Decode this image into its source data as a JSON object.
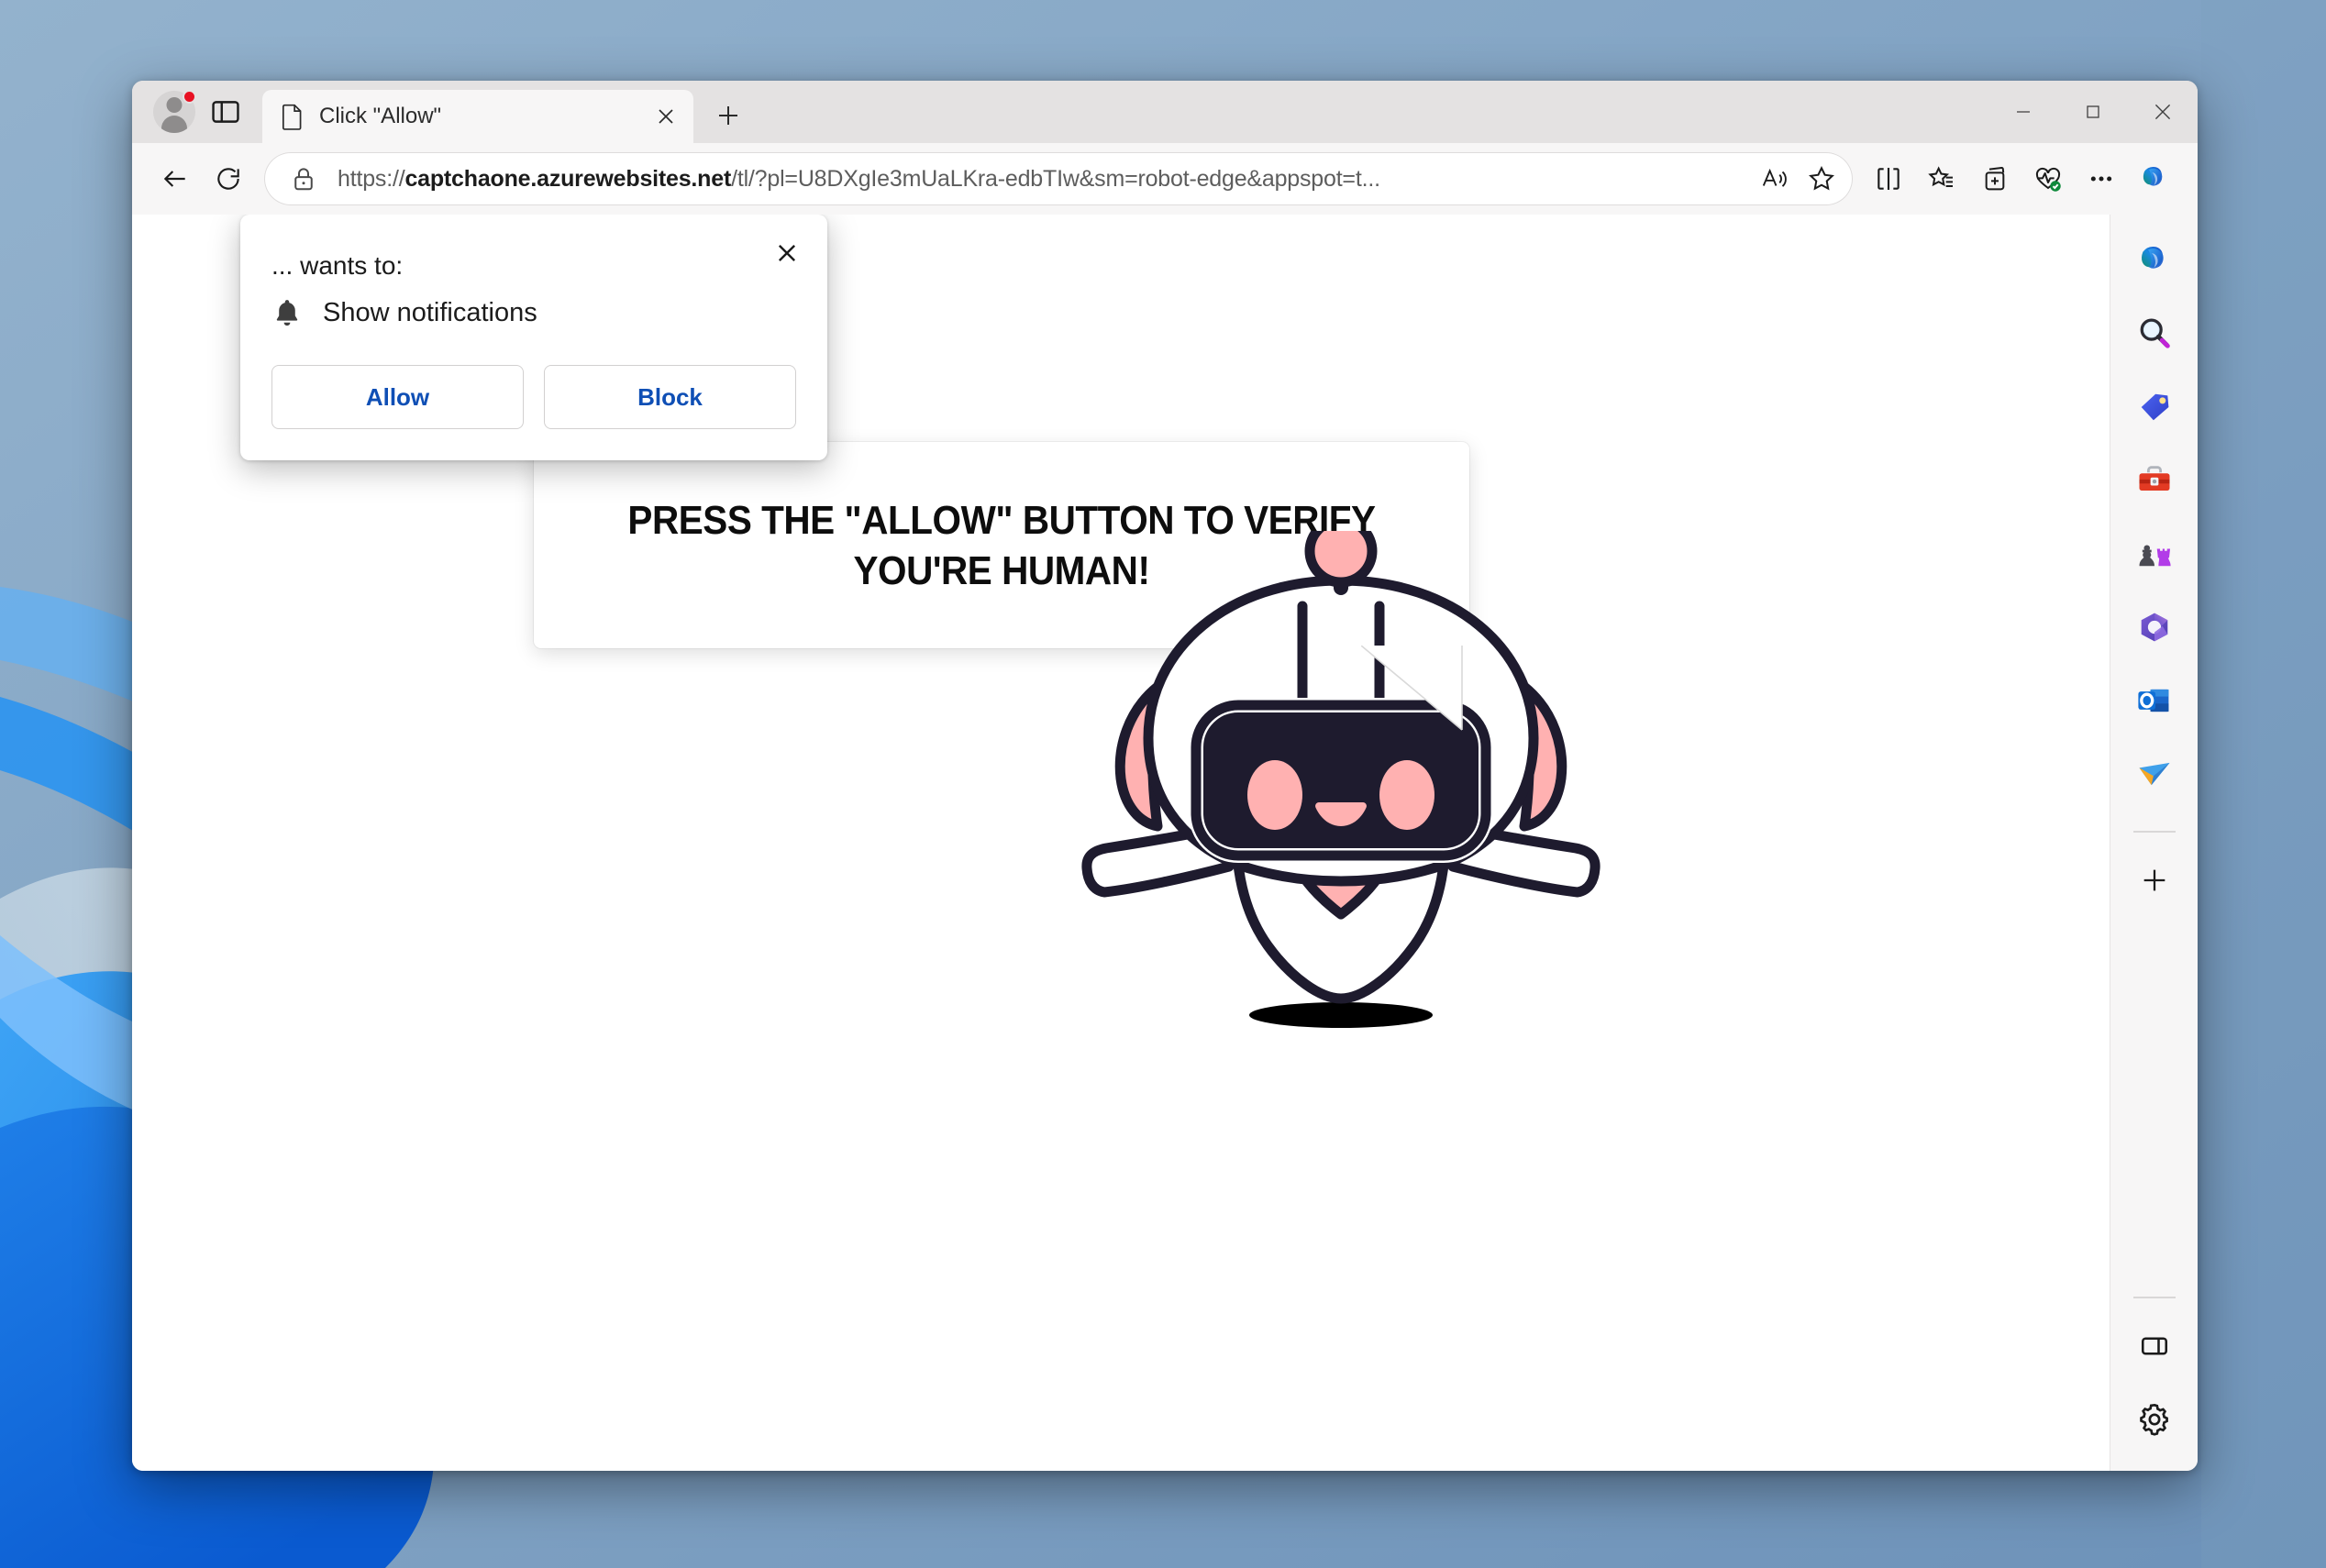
{
  "window": {
    "title": "Click \"Allow\"",
    "controls": {
      "minimize": "Minimize",
      "maximize": "Maximize",
      "close": "Close"
    }
  },
  "tabstrip": {
    "profile": "profile-avatar",
    "profile_badge": "notification-dot",
    "tab_actions_label": "Tab actions menu",
    "tabs": [
      {
        "title": "Click \"Allow\"",
        "favicon": "page-icon",
        "close_label": "Close tab"
      }
    ],
    "new_tab_label": "New tab"
  },
  "toolbar": {
    "back_label": "Back",
    "refresh_label": "Refresh",
    "security_icon": "lock-icon",
    "url_prefix": "https://",
    "url_domain": "captchaone.azurewebsites.net",
    "url_path": "/tl/?pl=U8DXgIe3mUaLKra-edbTIw&sm=robot-edge&appspot=t...",
    "url_full": "https://captchaone.azurewebsites.net/tl/?pl=U8DXgIe3mUaLKra-edbTIw&sm=robot-edge&appspot=t...",
    "read_aloud_label": "Read aloud",
    "favorite_label": "Add this page to favorites",
    "split_screen_label": "Split screen",
    "favorites_label": "Favorites",
    "collections_label": "Collections",
    "browser_essentials_label": "Browser essentials",
    "settings_more_label": "Settings and more",
    "copilot_label": "Copilot"
  },
  "sidebar": {
    "items": [
      {
        "name": "copilot-icon",
        "label": "Copilot"
      },
      {
        "name": "search-icon",
        "label": "Search"
      },
      {
        "name": "shopping-icon",
        "label": "Shopping"
      },
      {
        "name": "tools-icon",
        "label": "Tools"
      },
      {
        "name": "games-icon",
        "label": "Games"
      },
      {
        "name": "office-icon",
        "label": "Microsoft 365"
      },
      {
        "name": "outlook-icon",
        "label": "Outlook"
      },
      {
        "name": "skype-icon",
        "label": "Skype"
      }
    ],
    "add_label": "Customize",
    "split_pane_label": "Split pane",
    "settings_label": "Sidebar settings"
  },
  "permission_dialog": {
    "title": "... wants to:",
    "permission_icon": "bell-icon",
    "permission_label": "Show notifications",
    "allow_label": "Allow",
    "block_label": "Block",
    "close_label": "Close"
  },
  "page": {
    "bubble_text": "PRESS THE \"ALLOW\" BUTTON TO VERIFY YOU'RE HUMAN!",
    "mascot": "robot-mascot"
  },
  "colors": {
    "robot_outline": "#1e1b2e",
    "robot_accent": "#ffb1b1",
    "link_blue": "#0f4fb5",
    "badge_red": "#e81123",
    "desktop_blue": "#7d9fc0"
  }
}
